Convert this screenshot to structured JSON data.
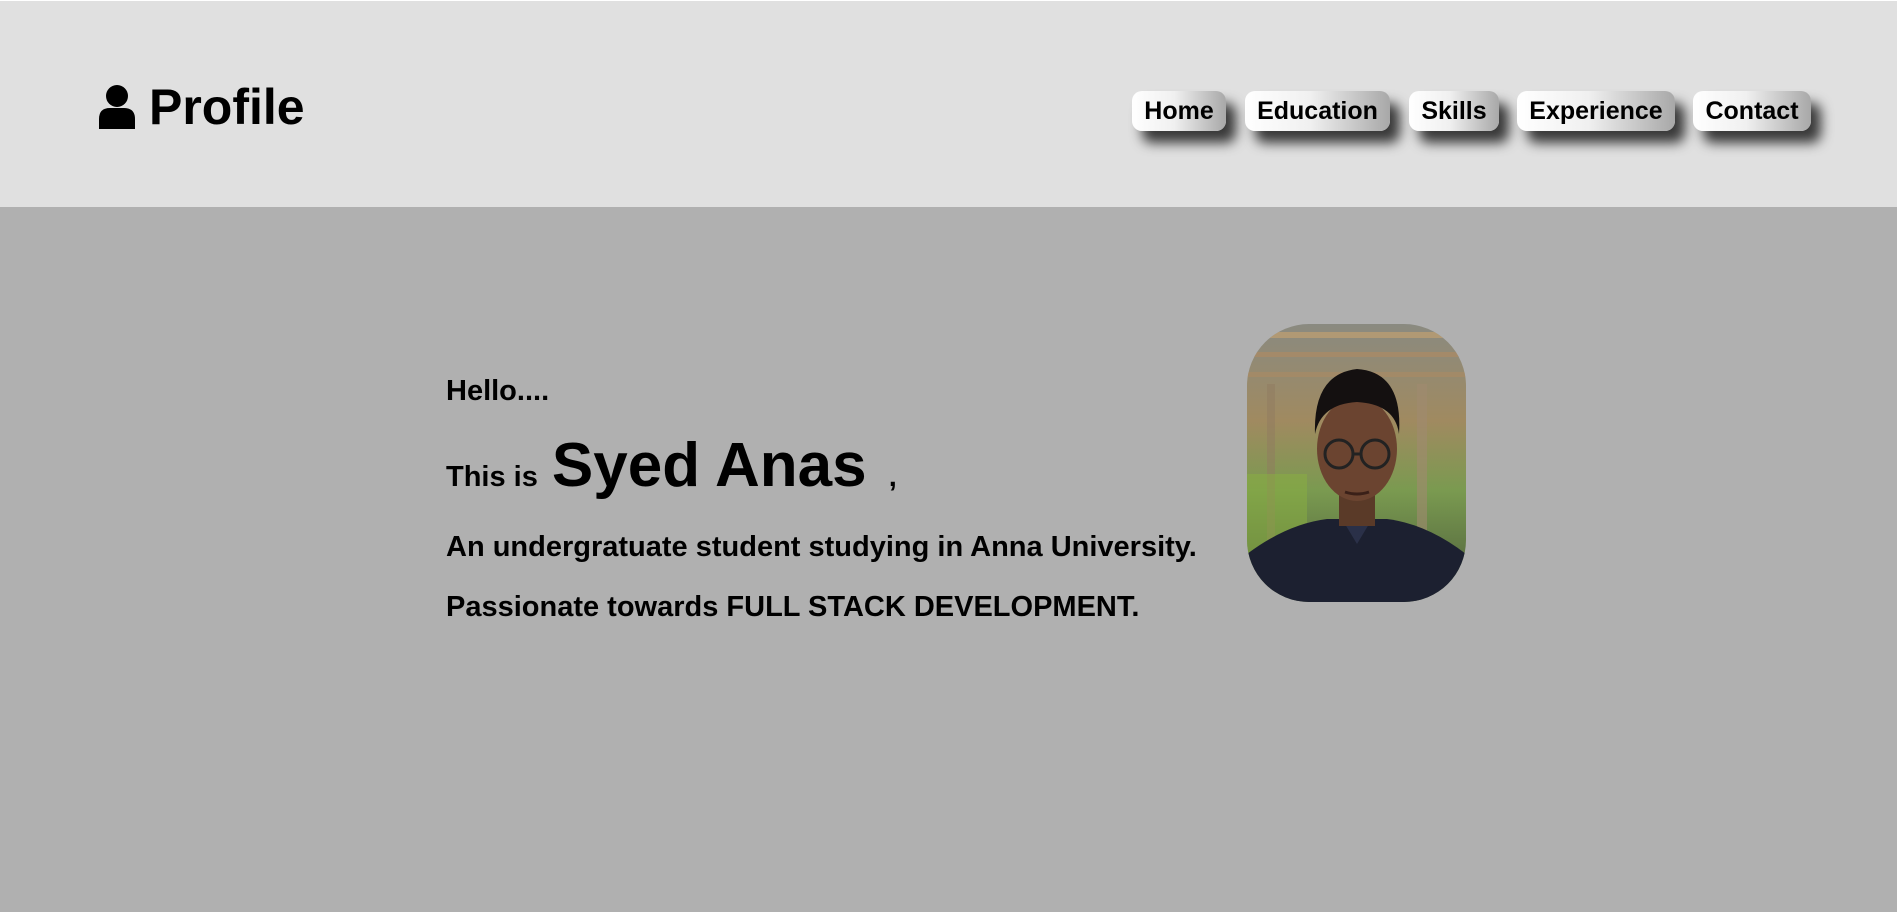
{
  "header": {
    "brand_icon": "user-icon",
    "brand_title": "Profile",
    "nav": [
      {
        "label": "Home"
      },
      {
        "label": "Education"
      },
      {
        "label": "Skills"
      },
      {
        "label": "Experience"
      },
      {
        "label": "Contact"
      }
    ]
  },
  "main": {
    "greeting": "Hello....",
    "intro_prefix": "This is",
    "name": "Syed Anas",
    "intro_suffix": ",",
    "line1": "An undergratuate student studying in Anna University.",
    "line2": "Passionate towards FULL STACK DEVELOPMENT."
  },
  "colors": {
    "header_bg": "#e0e0e0",
    "body_bg": "#b0b0b0",
    "text": "#000000"
  }
}
